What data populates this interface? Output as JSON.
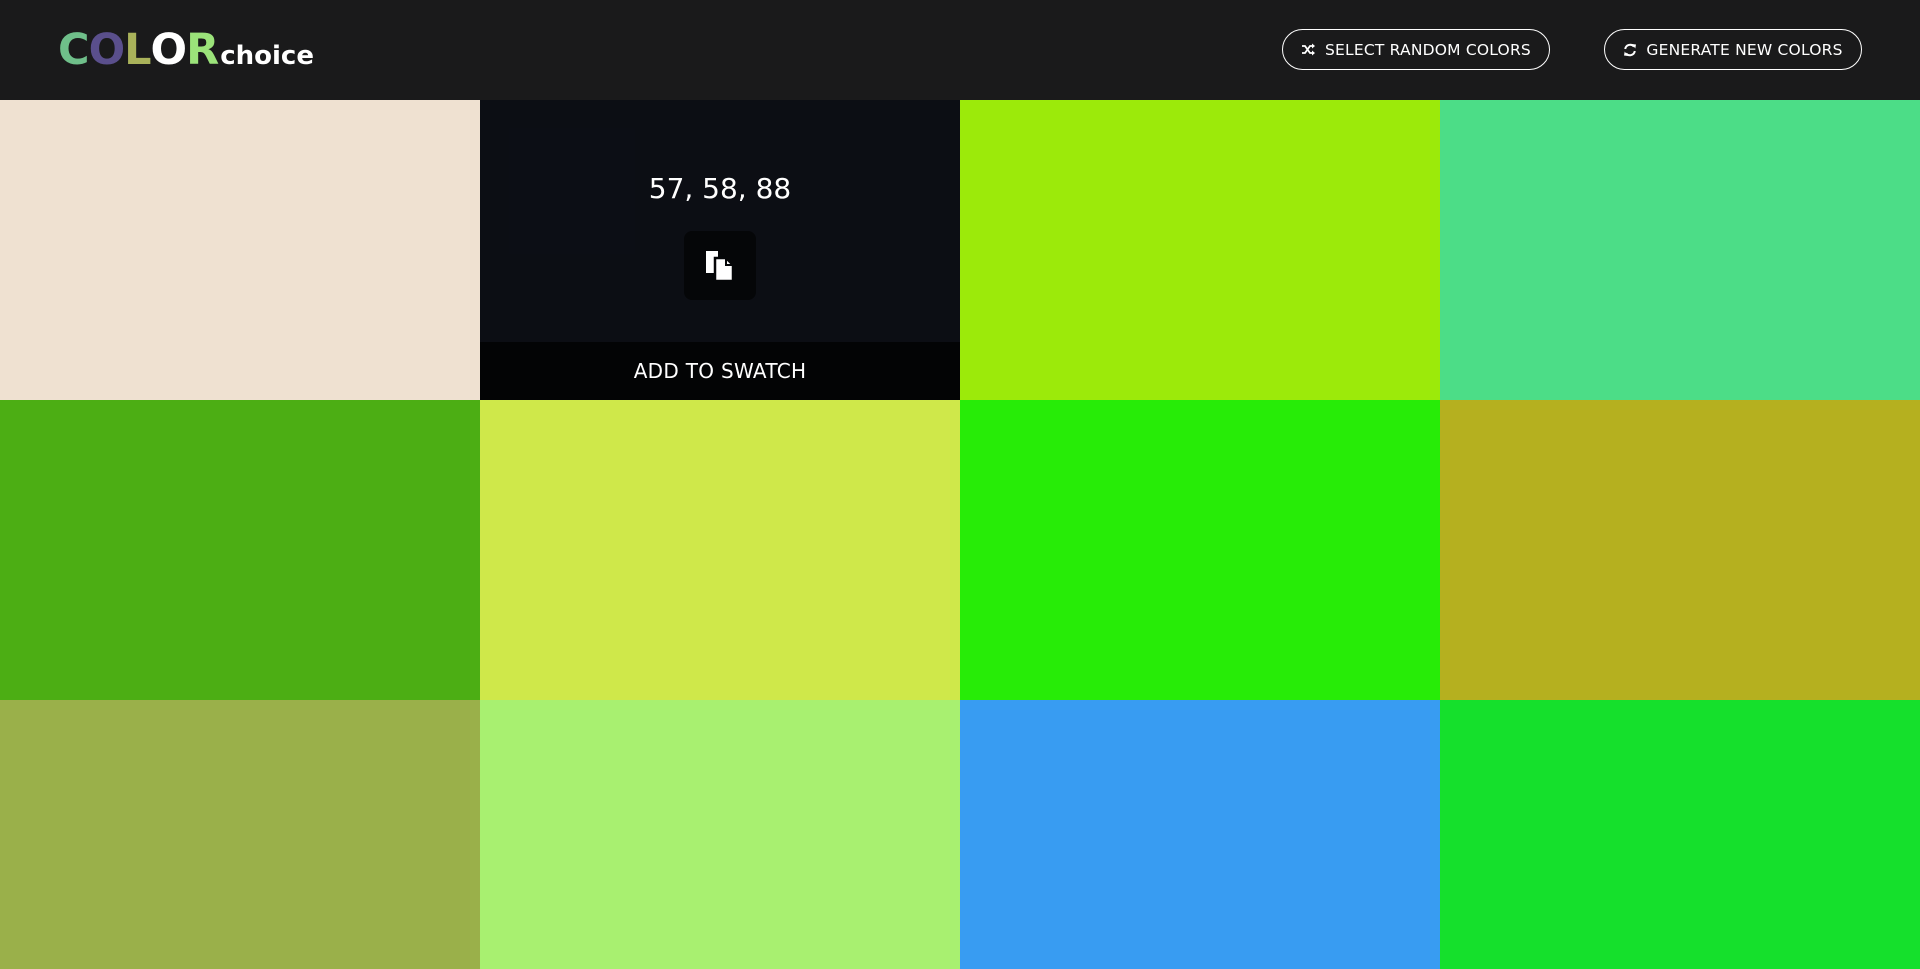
{
  "logo": {
    "letters": [
      {
        "char": "C",
        "color": "#6fbf8a"
      },
      {
        "char": "O",
        "color": "#5a4f8c"
      },
      {
        "char": "L",
        "color": "#a9b25a"
      },
      {
        "char": "O",
        "color": "#ffffff"
      },
      {
        "char": "R",
        "color": "#9be37a"
      }
    ],
    "suffix": "choice"
  },
  "toolbar": {
    "random_label": "SELECT RANDOM COLORS",
    "random_icon": "shuffle-icon",
    "generate_label": "GENERATE NEW COLORS",
    "generate_icon": "refresh-icon"
  },
  "swatches": [
    {
      "color": "#efe1d1"
    },
    {
      "color": "#393a58",
      "hovered": true,
      "rgb": "57, 58, 88",
      "copy_icon": "copy-icon",
      "add_label": "ADD TO SWATCH"
    },
    {
      "color": "#9cea0a"
    },
    {
      "color": "#4cdd87"
    },
    {
      "color": "#4cae14"
    },
    {
      "color": "#cfe84a"
    },
    {
      "color": "#27ec07"
    },
    {
      "color": "#b5b01f"
    },
    {
      "color": "#9ab04a"
    },
    {
      "color": "#a8f070"
    },
    {
      "color": "#389cf2"
    },
    {
      "color": "#15e02c"
    }
  ]
}
